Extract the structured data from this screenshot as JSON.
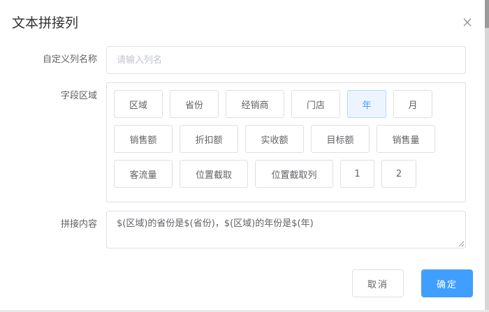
{
  "dialog": {
    "title": "文本拼接列",
    "close_icon": "close-icon"
  },
  "form": {
    "name_label": "自定义列名称",
    "name_value": "",
    "name_placeholder": "请输入列名",
    "field_label": "字段区域",
    "content_label": "拼接内容",
    "content_value": "$(区域)的省份是$(省份)，$(区域)的年份是$(年)"
  },
  "fields": [
    {
      "label": "区域",
      "active": false
    },
    {
      "label": "省份",
      "active": false
    },
    {
      "label": "经销商",
      "active": false
    },
    {
      "label": "门店",
      "active": false
    },
    {
      "label": "年",
      "active": true
    },
    {
      "label": "月",
      "active": false
    },
    {
      "label": "销售额",
      "active": false
    },
    {
      "label": "折扣额",
      "active": false
    },
    {
      "label": "实收额",
      "active": false
    },
    {
      "label": "目标额",
      "active": false
    },
    {
      "label": "销售量",
      "active": false
    },
    {
      "label": "客流量",
      "active": false
    },
    {
      "label": "位置截取",
      "active": false
    },
    {
      "label": "位置截取列",
      "active": false
    },
    {
      "label": "1",
      "active": false
    },
    {
      "label": "2",
      "active": false
    }
  ],
  "footer": {
    "cancel_label": "取消",
    "ok_label": "确定"
  },
  "colors": {
    "primary": "#409eff",
    "active_bg": "#ecf5ff",
    "border": "#dcdfe6"
  }
}
